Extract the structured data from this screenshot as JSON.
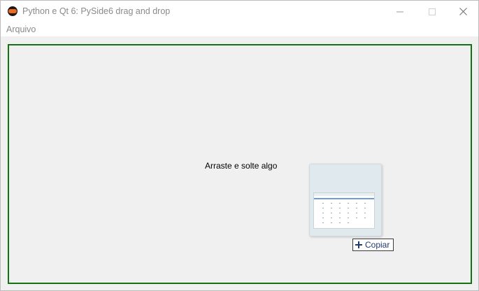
{
  "window": {
    "title": "Python e Qt 6: PySide6 drag and drop",
    "icon": "python-qt-icon",
    "controls": [
      "minimize-icon",
      "maximize-icon",
      "close-icon"
    ]
  },
  "menubar": {
    "items": [
      {
        "label": "Arquivo"
      }
    ]
  },
  "drop_area": {
    "label": "Arraste e solte algo",
    "border_color": "#137313"
  },
  "drag_feedback": {
    "preview": "dragged-screenshot-thumbnail",
    "action_icon": "plus-icon",
    "action_label": "Copiar"
  }
}
